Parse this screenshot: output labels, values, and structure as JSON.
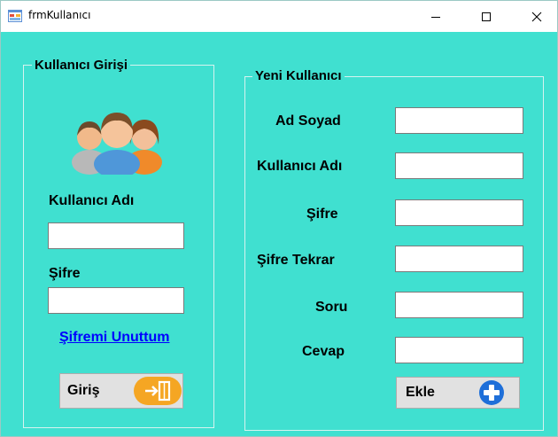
{
  "window": {
    "title": "frmKullanıcı"
  },
  "login": {
    "group_title": "Kullanıcı Girişi",
    "username_label": "Kullanıcı Adı",
    "username_value": "",
    "password_label": "Şifre",
    "password_value": "",
    "forgot_link": "Şifremi Unuttum",
    "login_button": "Giriş"
  },
  "new_user": {
    "group_title": "Yeni Kullanıcı",
    "fields": [
      {
        "label": "Ad Soyad",
        "value": ""
      },
      {
        "label": "Kullanıcı Adı",
        "value": ""
      },
      {
        "label": "Şifre",
        "value": ""
      },
      {
        "label": "Şifre Tekrar",
        "value": ""
      },
      {
        "label": "Soru",
        "value": ""
      },
      {
        "label": "Cevap",
        "value": ""
      }
    ],
    "add_button": "Ekle"
  },
  "icons": {
    "app": "window-app-icon",
    "users": "users-group-icon",
    "login": "exit-door-icon",
    "add": "plus-circle-icon"
  },
  "colors": {
    "background": "#40e0d0",
    "link": "#0000ff",
    "login_icon": "#f5a623",
    "add_icon": "#1e6fd9"
  }
}
